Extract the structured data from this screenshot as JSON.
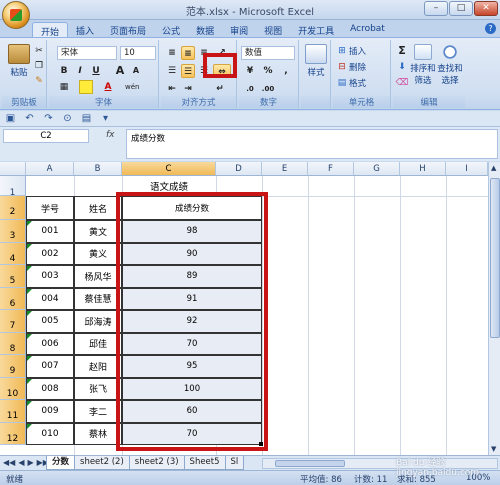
{
  "window": {
    "title": "范本.xlsx - Microsoft Excel",
    "controls": [
      "–",
      "□",
      "✕"
    ]
  },
  "tabs": [
    "开始",
    "插入",
    "页面布局",
    "公式",
    "数据",
    "审阅",
    "视图",
    "开发工具",
    "Acrobat"
  ],
  "ribbon": {
    "clipboard": {
      "label": "剪贴板",
      "paste": "粘贴"
    },
    "font": {
      "label": "字体",
      "font_name": "宋体",
      "font_size": "10",
      "bold": "B",
      "italic": "I",
      "underline": "U",
      "grow": "A",
      "shrink": "A",
      "font_color_glyph": "A",
      "phonetic": "wén"
    },
    "alignment": {
      "label": "对齐方式"
    },
    "number": {
      "label": "数字",
      "format": "数值",
      "percent": "%",
      "comma": ",",
      "currency": "¥"
    },
    "styles": {
      "label": "样式"
    },
    "cells": {
      "label": "单元格",
      "insert": "插入",
      "delete": "删除",
      "format": "格式"
    },
    "editing": {
      "label": "编辑",
      "sum": "Σ",
      "sort_filter": "排序和\n筛选",
      "find_select": "查找和\n选择"
    }
  },
  "formula_bar": {
    "name_box": "C2",
    "fx": "fx",
    "formula": "成绩分数"
  },
  "grid": {
    "columns": [
      "A",
      "B",
      "C",
      "D",
      "E",
      "F",
      "G",
      "H",
      "I"
    ],
    "rows": [
      "1",
      "2",
      "3",
      "4",
      "5",
      "6",
      "7",
      "8",
      "9",
      "10",
      "11",
      "12"
    ],
    "title_cell": "语文成绩",
    "headers": [
      "学号",
      "姓名",
      "成绩分数"
    ],
    "records": [
      {
        "id": "001",
        "name": "黄文",
        "score": "98"
      },
      {
        "id": "002",
        "name": "黄义",
        "score": "90"
      },
      {
        "id": "003",
        "name": "杨风华",
        "score": "89"
      },
      {
        "id": "004",
        "name": "蔡佳慧",
        "score": "91"
      },
      {
        "id": "005",
        "name": "邱海涛",
        "score": "92"
      },
      {
        "id": "006",
        "name": "邱佳",
        "score": "70"
      },
      {
        "id": "007",
        "name": "赵阳",
        "score": "95"
      },
      {
        "id": "008",
        "name": "张飞",
        "score": "100"
      },
      {
        "id": "009",
        "name": "李二",
        "score": "60"
      },
      {
        "id": "010",
        "name": "蔡林",
        "score": "70"
      }
    ]
  },
  "sheets": [
    "分数",
    "sheet2 (2)",
    "sheet2 (3)",
    "Sheet5",
    "Sl"
  ],
  "status": {
    "mode": "就绪",
    "average": "平均值: 86",
    "count": "计数: 11",
    "sum": "求和: 855",
    "zoom": "100%"
  },
  "watermark": "Bai du 经验 jingyan.baidu.com"
}
